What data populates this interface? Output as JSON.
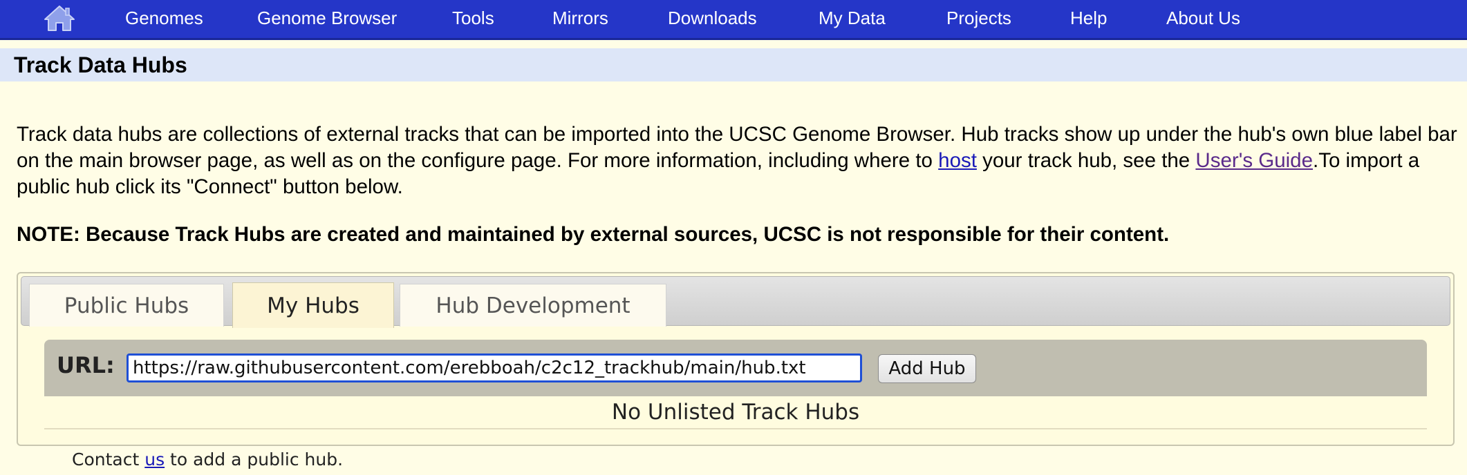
{
  "nav": {
    "home_icon": "home-icon",
    "items": [
      "Genomes",
      "Genome Browser",
      "Tools",
      "Mirrors",
      "Downloads",
      "My Data",
      "Projects",
      "Help",
      "About Us"
    ]
  },
  "page": {
    "title": "Track Data Hubs"
  },
  "intro": {
    "text_1": "Track data hubs are collections of external tracks that can be imported into the UCSC Genome Browser. Hub tracks show up under the hub's own blue label bar on the main browser page, as well as on the configure page. For more information, including where to ",
    "host_link": "host",
    "text_2": " your track hub, see the ",
    "guide_link": "User's Guide",
    "text_3": ".To import a public hub click its \"Connect\" button below."
  },
  "note": "NOTE: Because Track Hubs are created and maintained by external sources, UCSC is not responsible for their content.",
  "tabs": [
    {
      "label": "Public Hubs",
      "active": false
    },
    {
      "label": "My Hubs",
      "active": true
    },
    {
      "label": "Hub Development",
      "active": false
    }
  ],
  "url_form": {
    "label": "URL:",
    "value": "https://raw.githubusercontent.com/erebboah/c2c12_trackhub/main/hub.txt",
    "button_label": "Add Hub"
  },
  "no_hubs_text": "No Unlisted Track Hubs",
  "footer": {
    "text_before": "Contact ",
    "link": "us",
    "text_after": " to add a public hub."
  },
  "colors": {
    "nav_bg": "#2536c8",
    "title_bar_bg": "#dde6f8",
    "page_bg": "#fffde6",
    "link": "#1a1ab8",
    "link_visited": "#5a2a8a"
  }
}
